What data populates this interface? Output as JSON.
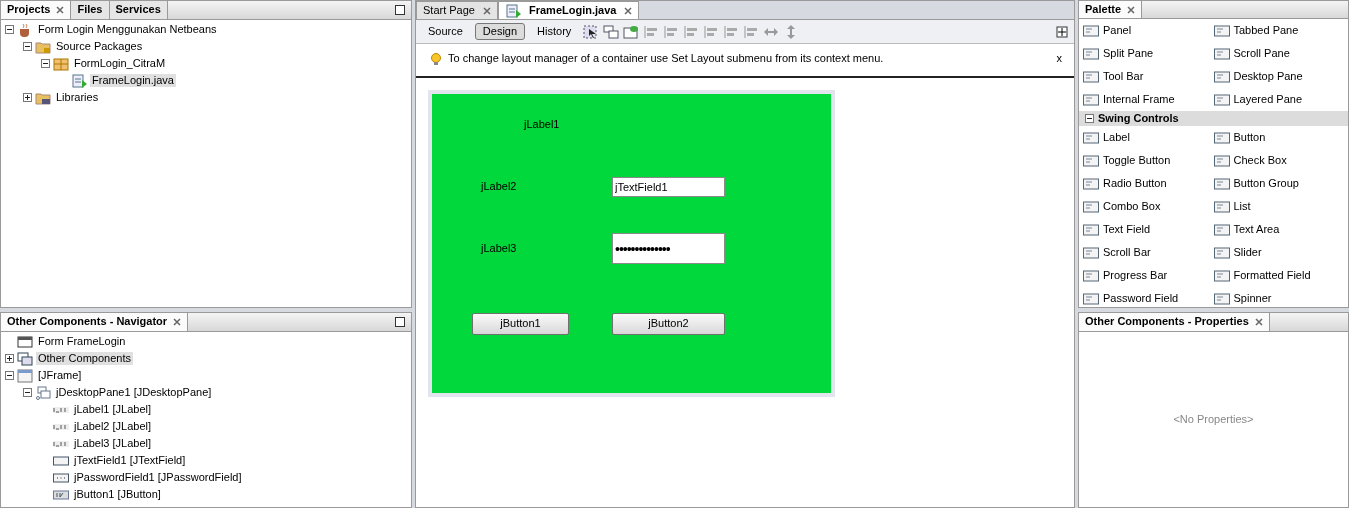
{
  "projects_panel": {
    "tabs": [
      {
        "label": "Projects",
        "selected": true
      },
      {
        "label": "Files",
        "selected": false
      },
      {
        "label": "Services",
        "selected": false
      }
    ],
    "tree": [
      {
        "label": "Form Login Menggunakan Netbeans",
        "kind": "project",
        "expanded": true,
        "selected": false,
        "children": [
          {
            "label": "Source Packages",
            "kind": "folder",
            "expanded": true,
            "selected": false,
            "children": [
              {
                "label": "FormLogin_CitraM",
                "kind": "package",
                "expanded": true,
                "selected": false,
                "children": [
                  {
                    "label": "FrameLogin.java",
                    "kind": "java",
                    "selected": true
                  }
                ]
              }
            ]
          },
          {
            "label": "Libraries",
            "kind": "library",
            "expanded": false,
            "selected": false
          }
        ]
      }
    ]
  },
  "navigator": {
    "title": "Other Components - Navigator",
    "tree": [
      {
        "label": "Form FrameLogin",
        "kind": "form",
        "selected": false
      },
      {
        "label": "Other Components",
        "kind": "components",
        "expanded": false,
        "selected": true
      },
      {
        "label": "[JFrame]",
        "kind": "frame",
        "expanded": true,
        "selected": false,
        "children": [
          {
            "label": "jDesktopPane1 [JDesktopPane]",
            "kind": "desktop",
            "expanded": true,
            "selected": false,
            "children": [
              {
                "label": "jLabel1 [JLabel]",
                "kind": "label",
                "selected": false
              },
              {
                "label": "jLabel2 [JLabel]",
                "kind": "label",
                "selected": false
              },
              {
                "label": "jLabel3 [JLabel]",
                "kind": "label",
                "selected": false
              },
              {
                "label": "jTextField1 [JTextField]",
                "kind": "textfield",
                "selected": false
              },
              {
                "label": "jPasswordField1 [JPasswordField]",
                "kind": "password",
                "selected": false
              },
              {
                "label": "jButton1 [JButton]",
                "kind": "button",
                "selected": false
              }
            ]
          }
        ]
      }
    ]
  },
  "editor": {
    "tabs": [
      {
        "label": "Start Page",
        "selected": false
      },
      {
        "label": "FrameLogin.java",
        "selected": true
      }
    ],
    "views": [
      {
        "label": "Source",
        "selected": false
      },
      {
        "label": "Design",
        "selected": true
      },
      {
        "label": "History",
        "selected": false
      }
    ],
    "hint": {
      "text": "To change layout manager of a container use Set Layout submenu from its context menu.",
      "close": "x"
    },
    "form": {
      "components": [
        {
          "kind": "label",
          "text": "jLabel1"
        },
        {
          "kind": "label",
          "text": "jLabel2"
        },
        {
          "kind": "textfield",
          "value": "jTextField1"
        },
        {
          "kind": "label",
          "text": "jLabel3"
        },
        {
          "kind": "password",
          "value": "••••••••••••••"
        },
        {
          "kind": "button",
          "text": "jButton1"
        },
        {
          "kind": "button",
          "text": "jButton2"
        }
      ]
    }
  },
  "palette": {
    "title": "Palette",
    "groups": [
      {
        "items": [
          "Panel",
          "Tabbed Pane",
          "Split Pane",
          "Scroll Pane",
          "Tool Bar",
          "Desktop Pane",
          "Internal Frame",
          "Layered Pane"
        ]
      },
      {
        "title": "Swing Controls",
        "expanded": true,
        "items": [
          "Label",
          "Button",
          "Toggle Button",
          "Check Box",
          "Radio Button",
          "Button Group",
          "Combo Box",
          "List",
          "Text Field",
          "Text Area",
          "Scroll Bar",
          "Slider",
          "Progress Bar",
          "Formatted Field",
          "Password Field",
          "Spinner"
        ]
      }
    ]
  },
  "properties": {
    "title": "Other Components - Properties",
    "empty": "<No Properties>"
  }
}
